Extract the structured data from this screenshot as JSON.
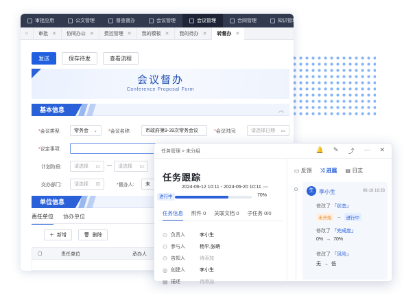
{
  "top_tabs": [
    {
      "label": "审批应用",
      "active": false
    },
    {
      "label": "公文管理",
      "active": false
    },
    {
      "label": "督查督办",
      "active": false
    },
    {
      "label": "会议管理",
      "active": false
    },
    {
      "label": "会议管理",
      "active": true
    },
    {
      "label": "合同管理",
      "active": false
    },
    {
      "label": "知识管理",
      "active": false
    }
  ],
  "sub_tabs": [
    {
      "label": "审批",
      "active": false
    },
    {
      "label": "协同办公",
      "active": false
    },
    {
      "label": "费控管理",
      "active": false
    },
    {
      "label": "我的模板",
      "active": false
    },
    {
      "label": "我的待办",
      "active": false
    },
    {
      "label": "转督办",
      "active": true
    }
  ],
  "toolbar": {
    "send": "发送",
    "save_pending": "保存待发",
    "view_flow": "查看流程"
  },
  "banner": {
    "title": "会议督办",
    "subtitle": "Conference Proposal Form"
  },
  "basic": {
    "header": "基本信息",
    "meeting_type_label": "会议类型:",
    "meeting_type_value": "常务会",
    "meeting_name_label": "会议名称:",
    "meeting_name_value": "市政府第9-39次常务会议",
    "meeting_time_label": "会议时间:",
    "meeting_time_placeholder": "请选择日期",
    "agenda_label": "议定事项:",
    "plan_label": "计划阶段:",
    "plan_start_placeholder": "请选择",
    "plan_end_placeholder": "请选择",
    "dept_label": "交办部门:",
    "dept_placeholder": "请选择",
    "supervisor_label": "督办人:",
    "supervisor_value": "未"
  },
  "unit": {
    "header": "单位信息",
    "tabs": [
      {
        "label": "责任单位",
        "active": true
      },
      {
        "label": "协办单位",
        "active": false
      }
    ],
    "add_button": "新增",
    "delete_button": "删除",
    "columns": [
      "责任单位",
      "承办人"
    ]
  },
  "panel": {
    "breadcrumb": "任务管理 > 未分组",
    "title": "任务跟踪",
    "date_range": "2024-06-12 10:11 - 2024-06-20 10:11",
    "status": "进行中",
    "progress": 70,
    "progress_label": "70%",
    "tabs": [
      {
        "label": "任务信息",
        "active": true
      },
      {
        "label": "附件 0",
        "active": false
      },
      {
        "label": "关联文档 0",
        "active": false
      },
      {
        "label": "子任务 0/0",
        "active": false
      }
    ],
    "info": [
      {
        "key": "负责人",
        "value": "李小生",
        "placeholder": false,
        "icon": "person-icon"
      },
      {
        "key": "参与人",
        "value": "杨平,张萌",
        "placeholder": false,
        "icon": "group-icon"
      },
      {
        "key": "告知人",
        "value": "待添加",
        "placeholder": true,
        "icon": "notify-person-icon"
      },
      {
        "key": "创建人",
        "value": "李小生",
        "placeholder": false,
        "icon": "creator-icon"
      },
      {
        "key": "描述",
        "value": "待添加",
        "placeholder": true,
        "icon": "document-icon"
      }
    ],
    "right_tabs": [
      {
        "label": "反馈",
        "active": false
      },
      {
        "label": "进展",
        "active": true
      },
      {
        "label": "日志",
        "active": false
      }
    ],
    "log": {
      "avatar": "生",
      "user": "李小生",
      "time": "06-18 16:33",
      "changes": [
        {
          "prefix": "修改了",
          "field": "「状态」",
          "from": "未开始",
          "to": "进行中"
        },
        {
          "prefix": "修改了",
          "field": "「完成度」",
          "from": "0%",
          "to": "70%"
        },
        {
          "prefix": "修改了",
          "field": "「风险」",
          "from": "无",
          "to": "低"
        }
      ]
    }
  }
}
